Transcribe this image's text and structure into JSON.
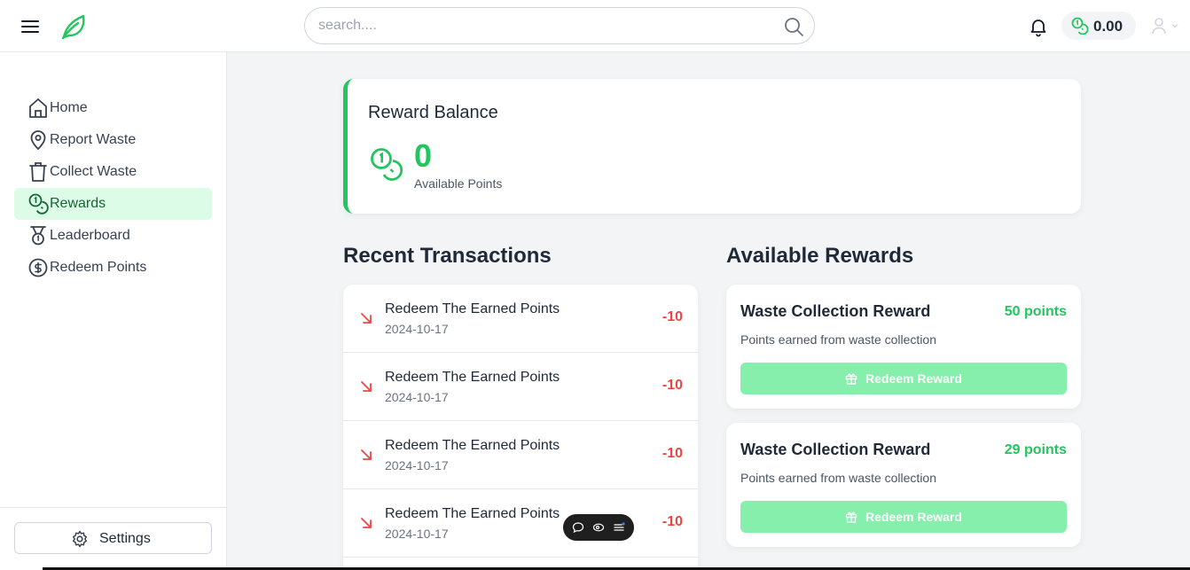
{
  "header": {
    "search_placeholder": "search....",
    "balance": "0.00"
  },
  "sidebar": {
    "items": [
      {
        "label": "Home",
        "icon": "home-icon"
      },
      {
        "label": "Report Waste",
        "icon": "map-pin-icon"
      },
      {
        "label": "Collect Waste",
        "icon": "trash-icon"
      },
      {
        "label": "Rewards",
        "icon": "coins-icon",
        "active": true
      },
      {
        "label": "Leaderboard",
        "icon": "medal-icon"
      },
      {
        "label": "Redeem Points",
        "icon": "dollar-circle-icon"
      }
    ],
    "settings_label": "Settings"
  },
  "balance_card": {
    "title": "Reward Balance",
    "value": "0",
    "subtitle": "Available Points"
  },
  "transactions": {
    "title": "Recent Transactions",
    "items": [
      {
        "description": "Redeem The Earned Points",
        "date": "2024-10-17",
        "amount": "-10"
      },
      {
        "description": "Redeem The Earned Points",
        "date": "2024-10-17",
        "amount": "-10"
      },
      {
        "description": "Redeem The Earned Points",
        "date": "2024-10-17",
        "amount": "-10"
      },
      {
        "description": "Redeem The Earned Points",
        "date": "2024-10-17",
        "amount": "-10"
      }
    ]
  },
  "rewards": {
    "title": "Available Rewards",
    "items": [
      {
        "name": "Waste Collection Reward",
        "points": "50 points",
        "description": "Points earned from waste collection",
        "button": "Redeem Reward"
      },
      {
        "name": "Waste Collection Reward",
        "points": "29 points",
        "description": "Points earned from waste collection",
        "button": "Redeem Reward"
      }
    ]
  },
  "colors": {
    "accent": "#22c55e",
    "active_bg": "#dcfce7",
    "negative": "#ef4444",
    "button_disabled": "#86efac"
  }
}
